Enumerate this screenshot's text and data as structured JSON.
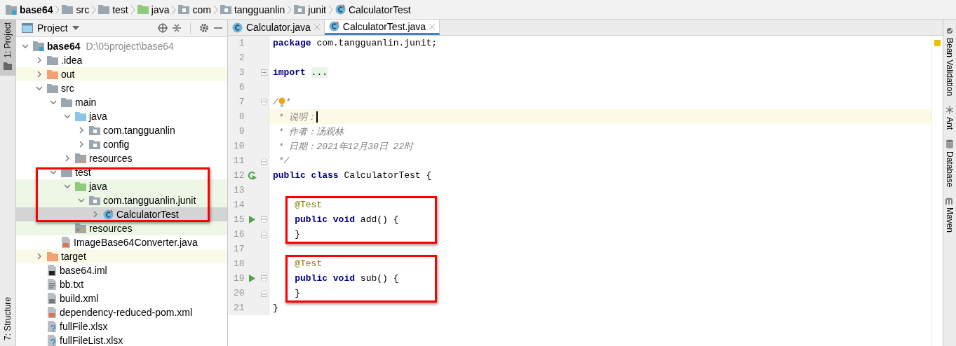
{
  "breadcrumb": [
    {
      "label": "base64",
      "kind": "module"
    },
    {
      "label": "src",
      "kind": "folder"
    },
    {
      "label": "test",
      "kind": "folder"
    },
    {
      "label": "java",
      "kind": "test-source"
    },
    {
      "label": "com",
      "kind": "package"
    },
    {
      "label": "tangguanlin",
      "kind": "package"
    },
    {
      "label": "junit",
      "kind": "package"
    },
    {
      "label": "CalculatorTest",
      "kind": "test-class"
    }
  ],
  "left_strip": [
    {
      "label": "1: Project",
      "selected": true
    },
    {
      "label": "7: Structure",
      "selected": false
    }
  ],
  "project_panel": {
    "title": "Project"
  },
  "project_tree": [
    {
      "label": "base64",
      "path": "D:\\05project\\base64",
      "kind": "module",
      "expanded": true,
      "selected": false,
      "children": [
        {
          "label": ".idea",
          "kind": "folder",
          "expanded": false,
          "selected": false
        },
        {
          "label": "out",
          "kind": "excluded",
          "expanded": false,
          "selected": false
        },
        {
          "label": "src",
          "kind": "folder",
          "expanded": true,
          "selected": false,
          "children": [
            {
              "label": "main",
              "kind": "folder",
              "expanded": true,
              "selected": false,
              "children": [
                {
                  "label": "java",
                  "kind": "source",
                  "expanded": true,
                  "selected": false,
                  "children": [
                    {
                      "label": "com.tangguanlin",
                      "kind": "package",
                      "expanded": false,
                      "selected": false
                    },
                    {
                      "label": "config",
                      "kind": "package",
                      "expanded": false,
                      "selected": false
                    }
                  ]
                },
                {
                  "label": "resources",
                  "kind": "resources",
                  "expanded": false,
                  "selected": false
                }
              ]
            },
            {
              "label": "test",
              "kind": "folder",
              "expanded": true,
              "selected": false,
              "framed": true,
              "children": [
                {
                  "label": "java",
                  "kind": "test-source",
                  "expanded": true,
                  "selected": false,
                  "framed": true,
                  "children": [
                    {
                      "label": "com.tangguanlin.junit",
                      "kind": "package",
                      "expanded": true,
                      "selected": false,
                      "framed": true,
                      "children": [
                        {
                          "label": "CalculatorTest",
                          "kind": "test-class",
                          "expanded": false,
                          "selected": true,
                          "framed": true
                        }
                      ]
                    }
                  ]
                },
                {
                  "label": "resources",
                  "kind": "test-resources",
                  "selected": false
                }
              ]
            },
            {
              "label": "ImageBase64Converter.java",
              "kind": "java-file",
              "selected": false
            }
          ]
        },
        {
          "label": "target",
          "kind": "excluded",
          "expanded": false,
          "selected": false
        },
        {
          "label": "base64.iml",
          "kind": "iml-file",
          "selected": false
        },
        {
          "label": "bb.txt",
          "kind": "text-file",
          "selected": false
        },
        {
          "label": "build.xml",
          "kind": "ant-file",
          "selected": false
        },
        {
          "label": "dependency-reduced-pom.xml",
          "kind": "xml-file",
          "selected": false
        },
        {
          "label": "fullFile.xlsx",
          "kind": "unknown-file",
          "selected": false
        },
        {
          "label": "fullFileList.xlsx",
          "kind": "unknown-file",
          "selected": false
        }
      ]
    }
  ],
  "editor_tabs": [
    {
      "label": "Calculator.java",
      "kind": "class",
      "selected": false
    },
    {
      "label": "CalculatorTest.java",
      "kind": "test-class",
      "selected": true
    }
  ],
  "code_lines": [
    {
      "number": "1",
      "current": false,
      "framed": false,
      "tokens": [
        {
          "kind": "keyword",
          "text": "package"
        },
        {
          "kind": "plain",
          "text": " com.tangguanlin.junit;"
        }
      ]
    },
    {
      "number": "2",
      "current": false,
      "framed": false
    },
    {
      "number": "3",
      "current": false,
      "framed": false,
      "fold": {
        "kind": "plus"
      },
      "tokens": [
        {
          "kind": "keyword",
          "text": "import"
        },
        {
          "kind": "folded",
          "text": "..."
        }
      ]
    },
    {
      "number": "6",
      "current": false,
      "framed": false
    },
    {
      "number": "7",
      "current": false,
      "framed": false,
      "fold": {
        "kind": "open"
      },
      "tokens": [
        {
          "kind": "comment",
          "text": "/"
        },
        {
          "kind": "bulb"
        },
        {
          "kind": "comment",
          "text": "*"
        }
      ]
    },
    {
      "number": "8",
      "current": true,
      "framed": false,
      "tokens": [
        {
          "kind": "comment",
          "text": " * 说明："
        },
        {
          "kind": "caret"
        }
      ]
    },
    {
      "number": "9",
      "current": false,
      "framed": false,
      "tokens": [
        {
          "kind": "comment",
          "text": " * 作者：汤观林"
        }
      ]
    },
    {
      "number": "10",
      "current": false,
      "framed": false,
      "tokens": [
        {
          "kind": "comment",
          "text": " * 日期：2021年12月30日 22时"
        }
      ]
    },
    {
      "number": "11",
      "current": false,
      "framed": false,
      "fold": {
        "kind": "close"
      },
      "tokens": [
        {
          "kind": "comment",
          "text": " */"
        }
      ]
    },
    {
      "number": "12",
      "current": false,
      "framed": false,
      "marker": {
        "kind": "run-class"
      },
      "tokens": [
        {
          "kind": "keyword",
          "text": "public class"
        },
        {
          "kind": "plain",
          "text": " CalculatorTest {"
        }
      ]
    },
    {
      "number": "13",
      "current": false,
      "framed": false
    },
    {
      "number": "14",
      "current": false,
      "framed": true,
      "tokens": [
        {
          "kind": "annotation",
          "text": "    @Test"
        }
      ]
    },
    {
      "number": "15",
      "current": false,
      "framed": true,
      "marker": {
        "kind": "run"
      },
      "fold": {
        "kind": "open"
      },
      "tokens": [
        {
          "kind": "keyword",
          "text": "    public void"
        },
        {
          "kind": "plain",
          "text": " add() {"
        }
      ]
    },
    {
      "number": "16",
      "current": false,
      "framed": true,
      "fold": {
        "kind": "close"
      },
      "tokens": [
        {
          "kind": "plain",
          "text": "    }"
        }
      ]
    },
    {
      "number": "17",
      "current": false,
      "framed": false
    },
    {
      "number": "18",
      "current": false,
      "framed": true,
      "tokens": [
        {
          "kind": "annotation",
          "text": "    @Test"
        }
      ]
    },
    {
      "number": "19",
      "current": false,
      "framed": true,
      "marker": {
        "kind": "run"
      },
      "fold": {
        "kind": "open"
      },
      "tokens": [
        {
          "kind": "keyword",
          "text": "    public void"
        },
        {
          "kind": "plain",
          "text": " sub() {"
        }
      ]
    },
    {
      "number": "20",
      "current": false,
      "framed": true,
      "fold": {
        "kind": "close"
      },
      "tokens": [
        {
          "kind": "plain",
          "text": "    }"
        }
      ]
    },
    {
      "number": "21",
      "current": false,
      "framed": false,
      "tokens": [
        {
          "kind": "plain",
          "text": "}"
        }
      ]
    }
  ],
  "right_strip": [
    {
      "label": "Bean Validation",
      "kind": "bean"
    },
    {
      "label": "Ant",
      "kind": "ant"
    },
    {
      "label": "Database",
      "kind": "database"
    },
    {
      "label": "Maven",
      "kind": "maven"
    }
  ]
}
